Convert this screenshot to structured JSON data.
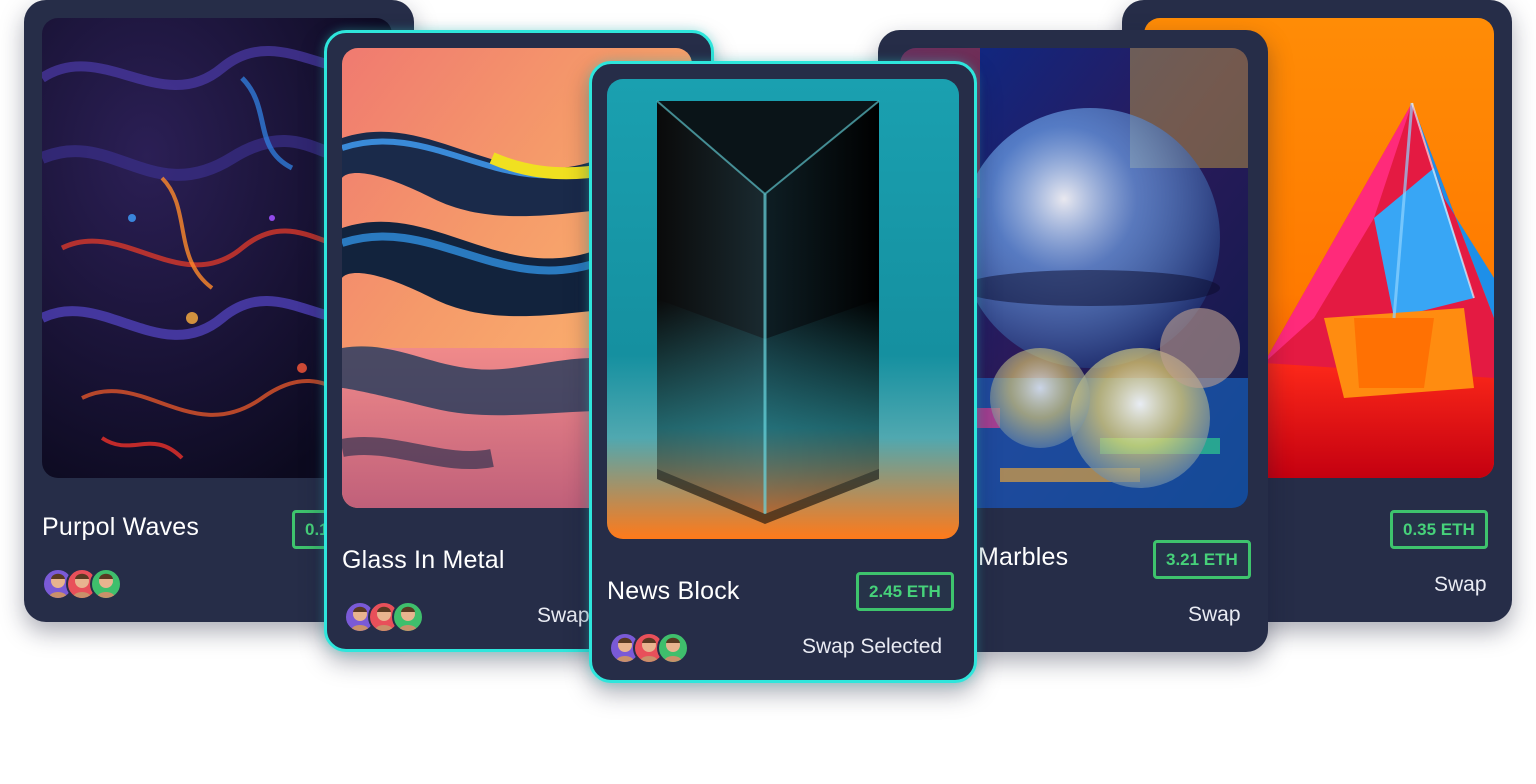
{
  "cards": [
    {
      "title": "Purpol Waves",
      "price": "0.1",
      "swap": "",
      "avatar_icon": "avatar-icon"
    },
    {
      "title": "Glass In Metal",
      "price": "",
      "swap": "Swap",
      "avatar_icon": "avatar-icon"
    },
    {
      "title": "News Block",
      "price": "2.45 ETH",
      "swap": "Swap Selected",
      "avatar_icon": "avatar-icon"
    },
    {
      "title": "Marbles",
      "price": "3.21 ETH",
      "swap": "Swap",
      "avatar_icon": "avatar-icon"
    },
    {
      "title": "",
      "price": "0.35 ETH",
      "swap": "Swap",
      "avatar_icon": "avatar-icon"
    }
  ],
  "colors": {
    "card_bg": "#262d48",
    "selected_border": "#2ee6dc",
    "price_green": "#46d27a",
    "text_white": "#ffffff"
  }
}
